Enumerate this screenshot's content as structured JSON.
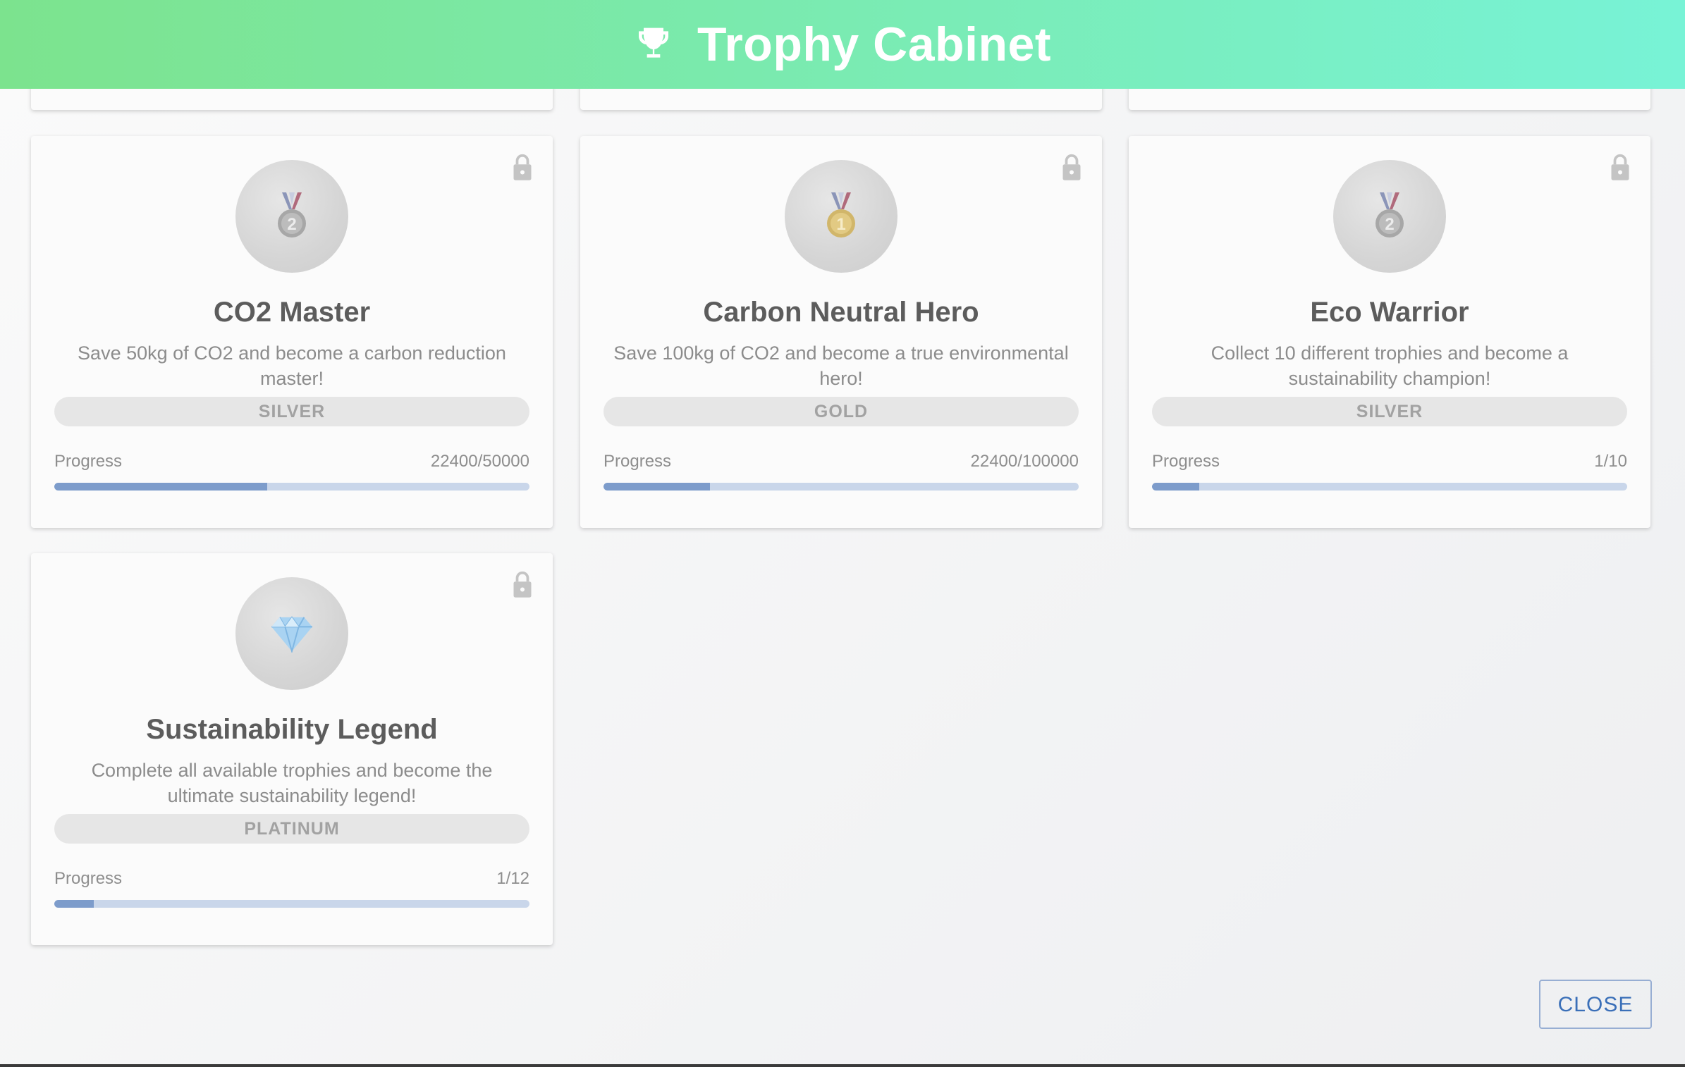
{
  "header": {
    "title": "Trophy Cabinet",
    "icon": "trophy-icon"
  },
  "trophies": [
    {
      "name": "CO2 Master",
      "description": "Save 50kg of CO2 and become a carbon reduction master!",
      "tier": "SILVER",
      "badge_icon": "second-place-medal-icon",
      "progress_label": "Progress",
      "progress_text": "22400/50000",
      "progress_fraction": 0.448,
      "locked": true
    },
    {
      "name": "Carbon Neutral Hero",
      "description": "Save 100kg of CO2 and become a true environmental hero!",
      "tier": "GOLD",
      "badge_icon": "first-place-medal-icon",
      "progress_label": "Progress",
      "progress_text": "22400/100000",
      "progress_fraction": 0.224,
      "locked": true
    },
    {
      "name": "Eco Warrior",
      "description": "Collect 10 different trophies and become a sustainability champion!",
      "tier": "SILVER",
      "badge_icon": "second-place-medal-icon",
      "progress_label": "Progress",
      "progress_text": "1/10",
      "progress_fraction": 0.1,
      "locked": true
    },
    {
      "name": "Sustainability Legend",
      "description": "Complete all available trophies and become the ultimate sustainability legend!",
      "tier": "PLATINUM",
      "badge_icon": "gem-icon",
      "progress_label": "Progress",
      "progress_text": "1/12",
      "progress_fraction": 0.0833,
      "locked": true
    }
  ],
  "footer": {
    "close_label": "CLOSE"
  },
  "colors": {
    "header_gradient_start": "#7ce38e",
    "header_gradient_end": "#78f3d6",
    "progress_fill": "#7d9ccb",
    "progress_track": "#c9d6ea",
    "close_text": "#3a6fb8"
  }
}
